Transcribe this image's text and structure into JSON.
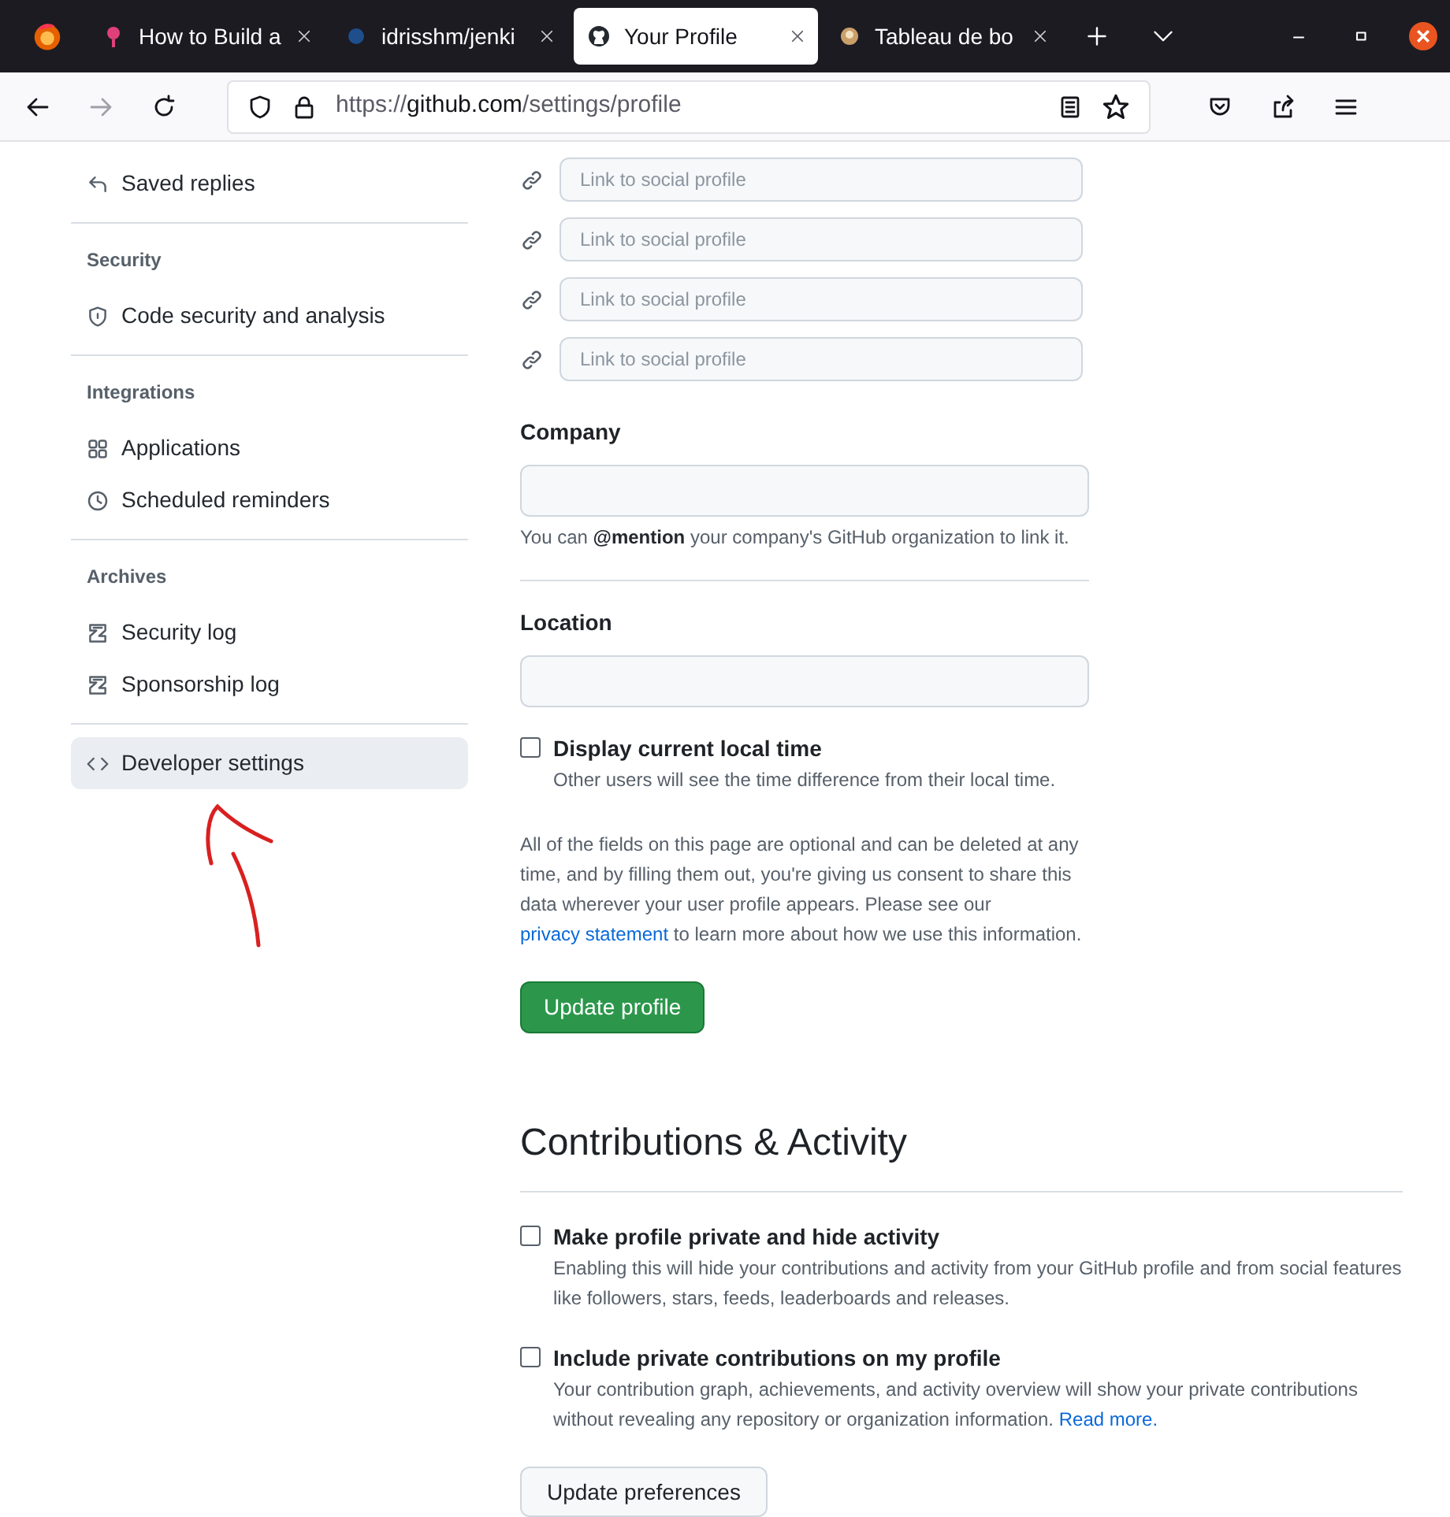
{
  "browser": {
    "tabs": [
      {
        "title": "How to Build a",
        "selected": false
      },
      {
        "title": "idrisshm/jenki",
        "selected": false
      },
      {
        "title": "Your Profile",
        "selected": true
      },
      {
        "title": "Tableau de bo",
        "selected": false
      }
    ],
    "url": "https://**github.com**/settings/profile"
  },
  "sidebar": {
    "groups": [
      {
        "items": [
          {
            "label": "Saved replies",
            "selected": false
          }
        ]
      },
      {
        "heading": "Security",
        "items": [
          {
            "label": "Code security and analysis",
            "selected": false
          }
        ]
      },
      {
        "heading": "Integrations",
        "items": [
          {
            "label": "Applications",
            "selected": false
          },
          {
            "label": "Scheduled reminders",
            "selected": false
          }
        ]
      },
      {
        "heading": "Archives",
        "items": [
          {
            "label": "Security log",
            "selected": false
          },
          {
            "label": "Sponsorship log",
            "selected": false
          }
        ]
      },
      {
        "items": [
          {
            "label": "Developer settings",
            "selected": true
          }
        ]
      }
    ]
  },
  "profile_form": {
    "social_links": [
      {
        "placeholder": "Link to social profile"
      },
      {
        "placeholder": "Link to social profile"
      },
      {
        "placeholder": "Link to social profile"
      },
      {
        "placeholder": "Link to social profile"
      }
    ],
    "company": {
      "label": "Company",
      "note": "You can **@mention** your company's GitHub organization to link it."
    },
    "location": {
      "label": "Location"
    },
    "local_time": {
      "label": "Display current local time",
      "description": "Other users will see the time difference from their local time.",
      "checked": false
    },
    "notice": {
      "text_before": "All of the fields on this page are optional and can be deleted at any time, and by filling them out, you're giving us consent to share this data wherever your user profile appears. Please see our",
      "link": "privacy statement",
      "text_after": "to learn more about how we use this information."
    },
    "submit": "Update profile"
  },
  "contributions": {
    "title": "Contributions & Activity",
    "options": [
      {
        "label": "Make profile private and hide activity",
        "description": "Enabling this will hide your contributions and activity from your GitHub profile and from social features like followers, stars, feeds, leaderboards and releases.",
        "checked": false
      },
      {
        "label": "Include private contributions on my profile",
        "description": "Your contribution graph, achievements, and activity overview will show your private contributions without revealing any repository or organization information.",
        "link": "Read more.",
        "checked": false
      }
    ],
    "submit": "Update preferences"
  }
}
